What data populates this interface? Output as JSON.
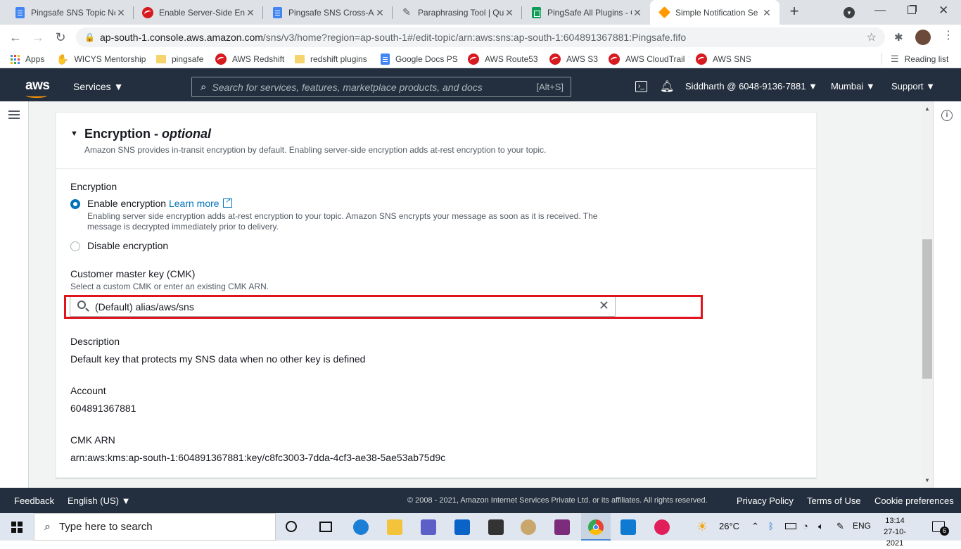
{
  "browser": {
    "tabs": [
      {
        "title": "Pingsafe SNS Topic Nc",
        "icon": "docs-icon"
      },
      {
        "title": "Enable Server-Side Enc",
        "icon": "trend-icon"
      },
      {
        "title": "Pingsafe SNS Cross-Ac",
        "icon": "docs-icon"
      },
      {
        "title": "Paraphrasing Tool | Qu",
        "icon": "quill-icon"
      },
      {
        "title": "PingSafe All Plugins - C",
        "icon": "sheets-icon"
      },
      {
        "title": "Simple Notification Se",
        "icon": "aws-cube-icon"
      }
    ],
    "url_host": "ap-south-1.console.aws.amazon.com",
    "url_path": "/sns/v3/home?region=ap-south-1#/edit-topic/arn:aws:sns:ap-south-1:604891367881:Pingsafe.fifo",
    "bookmarks": [
      {
        "label": "Apps"
      },
      {
        "label": "WICYS Mentorship"
      },
      {
        "label": "pingsafe"
      },
      {
        "label": "AWS Redshift"
      },
      {
        "label": "redshift plugins"
      },
      {
        "label": "Google Docs PS"
      },
      {
        "label": "AWS Route53"
      },
      {
        "label": "AWS S3"
      },
      {
        "label": "AWS CloudTrail"
      },
      {
        "label": "AWS SNS"
      }
    ],
    "reading_list": "Reading list"
  },
  "aws_header": {
    "logo": "aws",
    "services": "Services",
    "search_placeholder": "Search for services, features, marketplace products, and docs",
    "search_shortcut": "[Alt+S]",
    "account": "Siddharth @ 6048-9136-7881",
    "region": "Mumbai",
    "support": "Support"
  },
  "encryption_section": {
    "title": "Encryption",
    "title_suffix": "optional",
    "subtitle": "Amazon SNS provides in-transit encryption by default. Enabling server-side encryption adds at-rest encryption to your topic.",
    "field_label": "Encryption",
    "enable_label": "Enable encryption",
    "learn_more": "Learn more",
    "enable_desc_line1": "Enabling server side encryption adds at-rest encryption to your topic. Amazon SNS encrypts your message as soon as it is received. The",
    "enable_desc_line2": "message is decrypted immediately prior to delivery.",
    "disable_label": "Disable encryption",
    "selected": "enable",
    "cmk_label": "Customer master key (CMK)",
    "cmk_desc": "Select a custom CMK or enter an existing CMK ARN.",
    "cmk_value": "(Default) alias/aws/sns",
    "description_label": "Description",
    "description_value": "Default key that protects my SNS data when no other key is defined",
    "account_label": "Account",
    "account_value": "604891367881",
    "cmk_arn_label": "CMK ARN",
    "cmk_arn_value": "arn:aws:kms:ap-south-1:604891367881:key/c8fc3003-7dda-4cf3-ae38-5ae53ab75d9c"
  },
  "footer": {
    "feedback": "Feedback",
    "language": "English (US)",
    "copyright": "© 2008 - 2021, Amazon Internet Services Private Ltd. or its affiliates. All rights reserved.",
    "privacy": "Privacy Policy",
    "terms": "Terms of Use",
    "cookies": "Cookie preferences"
  },
  "taskbar": {
    "search_placeholder": "Type here to search",
    "weather": "26°C",
    "language": "ENG",
    "time": "13:14",
    "date": "27-10-2021",
    "notifications": "6"
  },
  "colors": {
    "aws_header": "#232f3e",
    "aws_orange": "#ff9900",
    "link_blue": "#0073bb",
    "highlight_red": "#e1141e"
  }
}
